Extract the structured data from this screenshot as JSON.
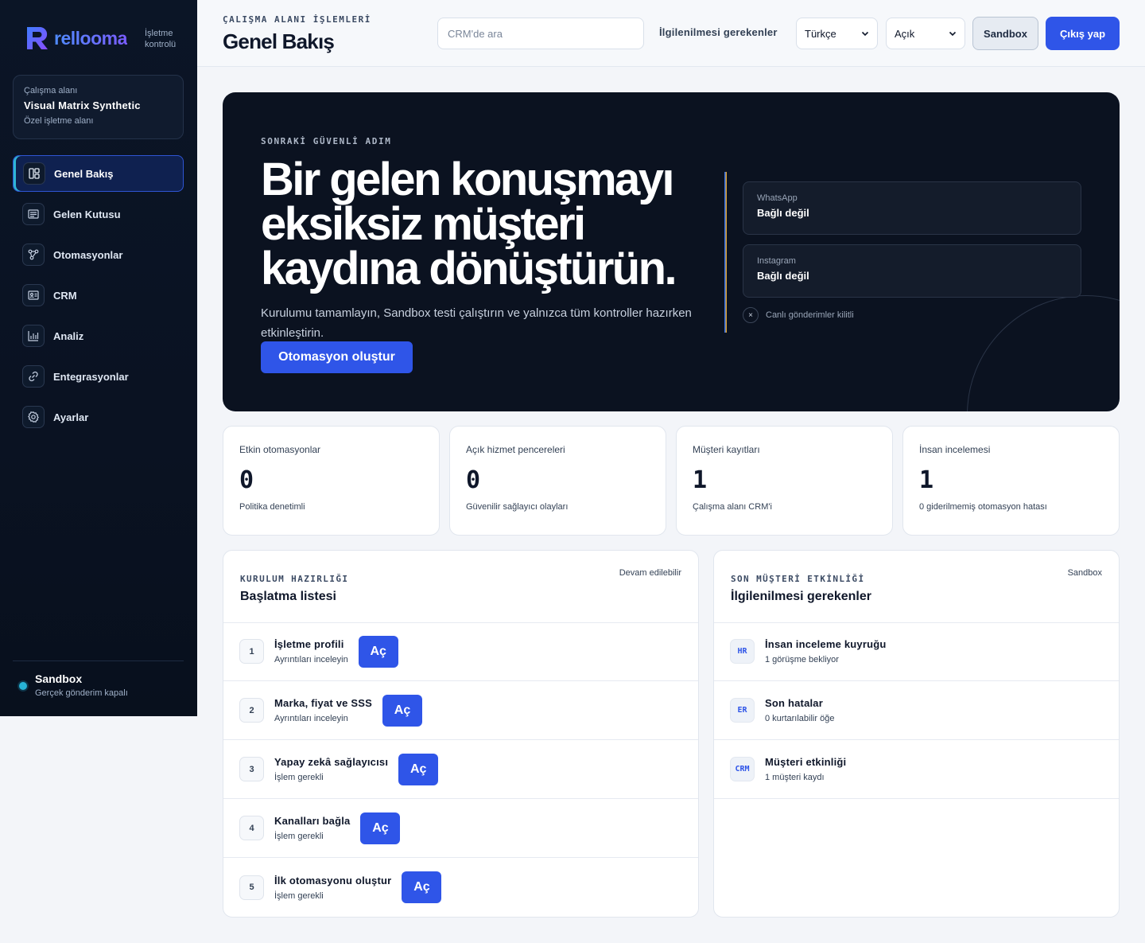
{
  "brand": {
    "name": "rellooma",
    "subtitle_line1": "İşletme",
    "subtitle_line2": "kontrolü",
    "accent": "#2f55e8"
  },
  "workspace": {
    "label": "Çalışma alanı",
    "name": "Visual Matrix Synthetic",
    "type": "Özel işletme alanı"
  },
  "sidebar": {
    "items": [
      {
        "label": "Genel Bakış",
        "icon": "dashboard-icon",
        "active": true
      },
      {
        "label": "Gelen Kutusu",
        "icon": "inbox-icon"
      },
      {
        "label": "Otomasyonlar",
        "icon": "workflow-icon"
      },
      {
        "label": "CRM",
        "icon": "contact-card-icon"
      },
      {
        "label": "Analiz",
        "icon": "bar-chart-icon"
      },
      {
        "label": "Entegrasyonlar",
        "icon": "link-icon"
      },
      {
        "label": "Ayarlar",
        "icon": "gear-icon"
      }
    ],
    "environment": {
      "name": "Sandbox",
      "description": "Gerçek gönderim kapalı",
      "dot_color": "#27b3d6"
    }
  },
  "header": {
    "kicker": "ÇALIŞMA ALANI İŞLEMLERİ",
    "title": "Genel Bakış",
    "search_placeholder": "CRM'de ara",
    "attention_link": "İlgilenilmesi gerekenler",
    "language": "Türkçe",
    "theme": "Açık",
    "sandbox_button": "Sandbox",
    "logout_button": "Çıkış yap"
  },
  "hero": {
    "kicker": "SONRAKİ GÜVENLİ ADIM",
    "title": "Bir gelen konuşmayı eksiksiz müşteri kaydına dönüştürün.",
    "description": "Kurulumu tamamlayın, Sandbox testi çalıştırın ve yalnızca tüm kontroller hazırken etkinleştirin.",
    "button": "Otomasyon oluştur",
    "channels": [
      {
        "name": "WhatsApp",
        "status": "Bağlı değil"
      },
      {
        "name": "Instagram",
        "status": "Bağlı değil"
      }
    ],
    "lock_text": "Canlı gönderimler kilitli",
    "lock_icon": "×"
  },
  "stats": [
    {
      "label": "Etkin otomasyonlar",
      "value": "0",
      "note": "Politika denetimli"
    },
    {
      "label": "Açık hizmet pencereleri",
      "value": "0",
      "note": "Güvenilir sağlayıcı olayları"
    },
    {
      "label": "Müşteri kayıtları",
      "value": "1",
      "note": "Çalışma alanı CRM'i"
    },
    {
      "label": "İnsan incelemesi",
      "value": "1",
      "note": "0 giderilmemiş otomasyon hatası"
    }
  ],
  "setup": {
    "kicker": "KURULUM HAZIRLIĞI",
    "title": "Başlatma listesi",
    "tag": "Devam edilebilir",
    "action_label": "Aç",
    "items": [
      {
        "num": "1",
        "title": "İşletme profili",
        "sub": "Ayrıntıları inceleyin"
      },
      {
        "num": "2",
        "title": "Marka, fiyat ve SSS",
        "sub": "Ayrıntıları inceleyin"
      },
      {
        "num": "3",
        "title": "Yapay zekâ sağlayıcısı",
        "sub": "İşlem gerekli"
      },
      {
        "num": "4",
        "title": "Kanalları bağla",
        "sub": "İşlem gerekli"
      },
      {
        "num": "5",
        "title": "İlk otomasyonu oluştur",
        "sub": "İşlem gerekli"
      }
    ]
  },
  "activity": {
    "kicker": "SON MÜŞTERİ ETKİNLİĞİ",
    "title": "İlgilenilmesi gerekenler",
    "tag": "Sandbox",
    "items": [
      {
        "badge": "HR",
        "title": "İnsan inceleme kuyruğu",
        "sub": "1 görüşme bekliyor"
      },
      {
        "badge": "ER",
        "title": "Son hatalar",
        "sub": "0 kurtarılabilir öğe"
      },
      {
        "badge": "CRM",
        "title": "Müşteri etkinliği",
        "sub": "1 müşteri kaydı"
      }
    ]
  }
}
